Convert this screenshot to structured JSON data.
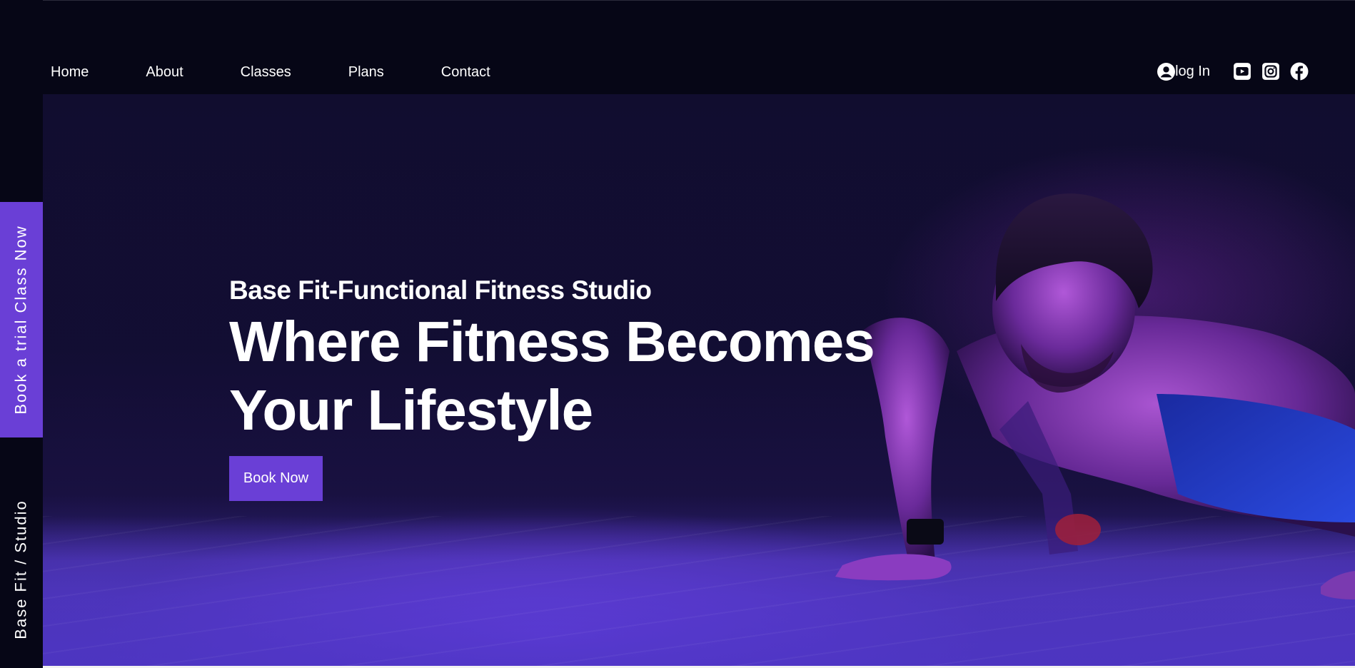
{
  "nav": {
    "items": [
      "Home",
      "About",
      "Classes",
      "Plans",
      "Contact"
    ]
  },
  "header": {
    "login_label": "log In",
    "icons": [
      "user-icon",
      "youtube-icon",
      "instagram-icon",
      "facebook-icon"
    ]
  },
  "side": {
    "trial_label": "Book a trial Class Now",
    "studio_label": "Base Fit / Studio"
  },
  "hero": {
    "subtitle": "Base Fit-Functional Fitness Studio",
    "headline_line1": "Where Fitness Becomes",
    "headline_line2": "Your Lifestyle",
    "cta_label": "Book Now"
  },
  "colors": {
    "accent": "#6a3fd6",
    "background": "#060616",
    "text": "#ffffff"
  }
}
